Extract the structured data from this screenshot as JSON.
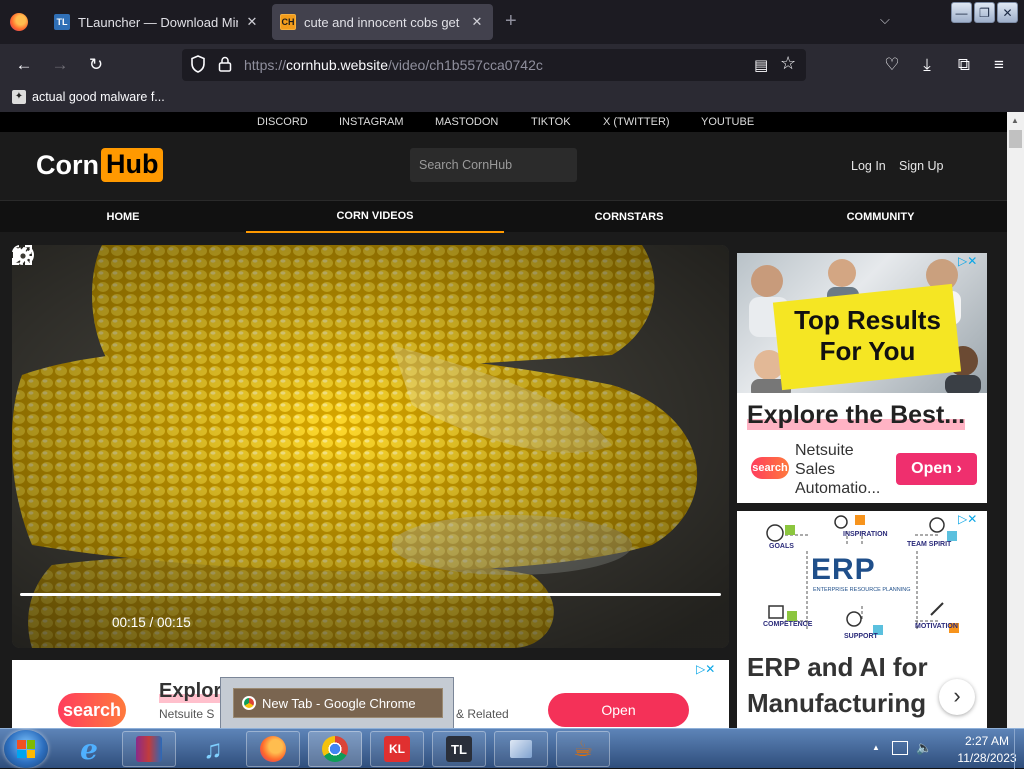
{
  "browser": {
    "tabs": [
      {
        "title": "TLauncher — Download Minecraft",
        "favicon": "TL"
      },
      {
        "title": "cute and innocent cobs get BOILED",
        "favicon": "CH",
        "active": true
      }
    ],
    "url": {
      "prefix": "https://",
      "host": "cornhub.website",
      "path": "/video/ch1b557cca0742c"
    },
    "bookmarks": [
      {
        "label": "actual good malware f..."
      }
    ]
  },
  "site": {
    "social_links": [
      "DISCORD",
      "INSTAGRAM",
      "MASTODON",
      "TIKTOK",
      "X (TWITTER)",
      "YOUTUBE"
    ],
    "logo": {
      "part1": "Corn",
      "part2": "Hub"
    },
    "search_placeholder": "Search CornHub",
    "login_label": "Log In",
    "signup_label": "Sign Up",
    "nav": [
      "HOME",
      "CORN VIDEOS",
      "CORNSTARS",
      "COMMUNITY"
    ],
    "nav_active": "CORN VIDEOS",
    "accent_color": "#ff9900"
  },
  "video": {
    "time": "00:15 / 00:15",
    "progress": 1.0
  },
  "ads": {
    "bottom": {
      "logo": "search",
      "title": "Explor",
      "subtitle": "Netsuite S",
      "related": "& Related",
      "button": "Open"
    },
    "side_top": {
      "headline": "Top Results For You",
      "explore": "Explore the Best...",
      "logo": "search",
      "body": "Netsuite Sales Automatio...",
      "button": "Open ›"
    },
    "side_erp": {
      "logo": "ERP",
      "logo_sub": "ENTERPRISE RESOURCE PLANNING",
      "labels": [
        "GOALS",
        "INSPIRATION",
        "TEAM SPIRIT",
        "COMPETENCE",
        "SUPPORT",
        "MOTIVATION"
      ],
      "headline_line1": "ERP and AI for",
      "headline_line2": "Manufacturing",
      "arrow": "›"
    }
  },
  "popup": {
    "label": "New Tab - Google Chrome"
  },
  "taskbar": {
    "items": [
      "start",
      "internet-explorer",
      "winrar",
      "itunes",
      "firefox",
      "chrome",
      "kl",
      "tlauncher",
      "network-app",
      "java"
    ],
    "kl_label": "KL",
    "tl_label": "TL",
    "clock_time": "2:27 AM",
    "clock_date": "11/28/2023"
  }
}
